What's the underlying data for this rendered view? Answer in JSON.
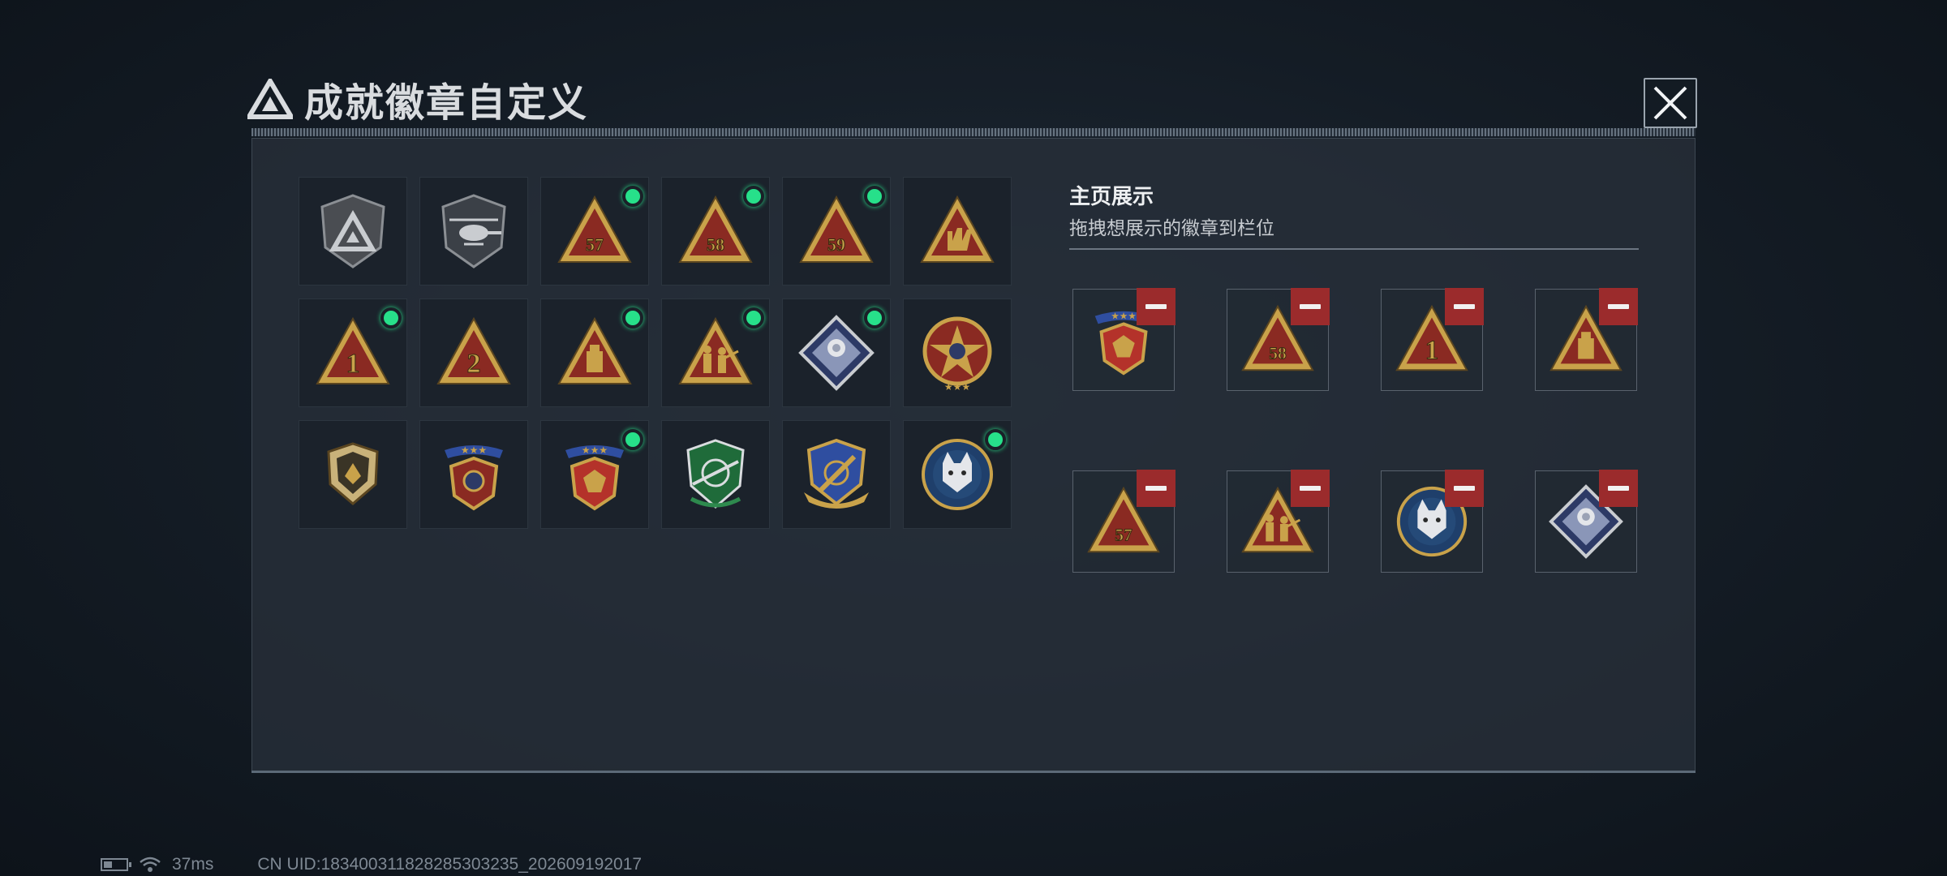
{
  "header": {
    "title": "成就徽章自定义",
    "close_icon": "close-icon"
  },
  "colors": {
    "accent_gold": "#c9a24a",
    "badge_red": "#8a2a22",
    "new_dot": "#27e08a",
    "remove_red": "#9b2b2c"
  },
  "badge_grid": [
    {
      "kind": "emblem-shield",
      "new": false
    },
    {
      "kind": "helicopter",
      "new": false
    },
    {
      "kind": "triangle",
      "label": "57",
      "new": true
    },
    {
      "kind": "triangle",
      "label": "58",
      "new": true
    },
    {
      "kind": "triangle",
      "label": "59",
      "new": true
    },
    {
      "kind": "triangle-hand",
      "new": false
    },
    {
      "kind": "triangle",
      "label": "1",
      "new": true
    },
    {
      "kind": "triangle",
      "label": "2",
      "new": false
    },
    {
      "kind": "triangle-block",
      "new": true
    },
    {
      "kind": "triangle-soldiers",
      "new": true
    },
    {
      "kind": "diamond-rose",
      "new": true
    },
    {
      "kind": "star-round",
      "new": false
    },
    {
      "kind": "shield-small",
      "new": false
    },
    {
      "kind": "crest-stars",
      "new": false
    },
    {
      "kind": "crest-gem",
      "new": true
    },
    {
      "kind": "shield-green",
      "new": false
    },
    {
      "kind": "shield-sword",
      "new": false
    },
    {
      "kind": "round-lynx",
      "new": true
    }
  ],
  "showcase": {
    "title": "主页展示",
    "subtitle": "拖拽想展示的徽章到栏位",
    "slots": [
      {
        "kind": "crest-gem"
      },
      {
        "kind": "triangle",
        "label": "58"
      },
      {
        "kind": "triangle",
        "label": "1"
      },
      {
        "kind": "triangle-block"
      },
      {
        "kind": "triangle",
        "label": "57"
      },
      {
        "kind": "triangle-soldiers"
      },
      {
        "kind": "round-lynx"
      },
      {
        "kind": "diamond-rose"
      }
    ],
    "remove_icon": "minus-icon"
  },
  "status": {
    "ping": "37ms",
    "uid": "CN UID:1834003118282853032​35_202609192017"
  }
}
